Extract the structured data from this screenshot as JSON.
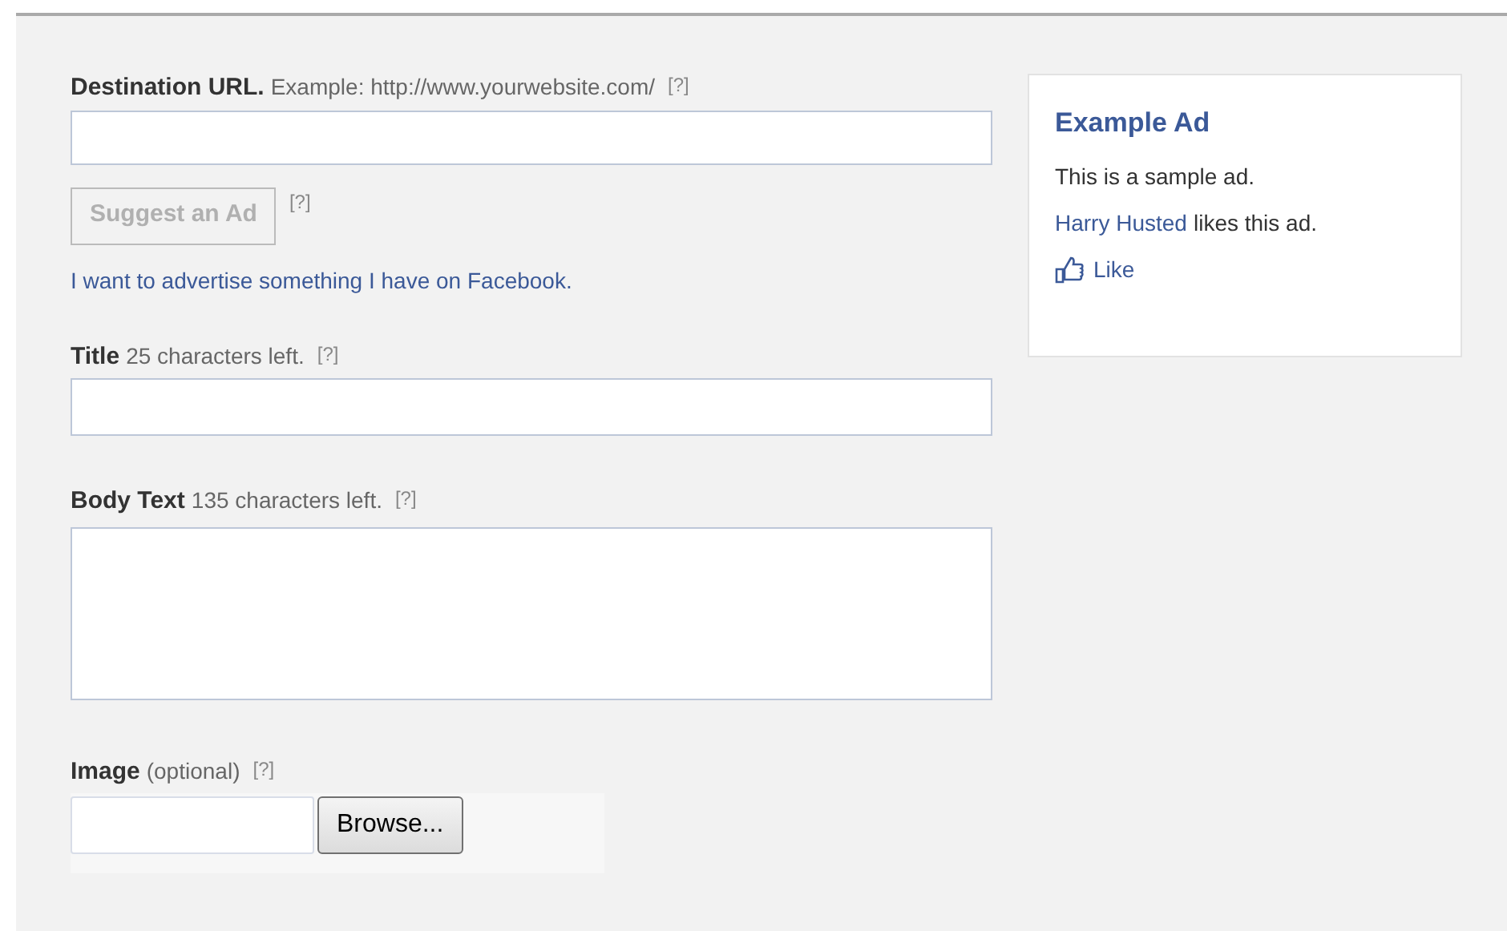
{
  "form": {
    "destination": {
      "label": "Destination URL.",
      "hint": "Example: http://www.yourwebsite.com/",
      "help": "[?]"
    },
    "suggest_button": {
      "label": "Suggest an Ad",
      "disabled": true,
      "help": "[?]"
    },
    "facebook_link": "I want to advertise something I have on Facebook.",
    "title": {
      "label": "Title",
      "hint": "25 characters left.",
      "help": "[?]"
    },
    "body": {
      "label": "Body Text",
      "hint": "135 characters left.",
      "help": "[?]"
    },
    "image": {
      "label": "Image",
      "hint": "(optional)",
      "help": "[?]",
      "browse_button": "Browse..."
    }
  },
  "preview": {
    "title": "Example Ad",
    "body": "This is a sample ad.",
    "liker": "Harry Husted",
    "like_text": "likes this ad.",
    "like_button": "Like"
  }
}
